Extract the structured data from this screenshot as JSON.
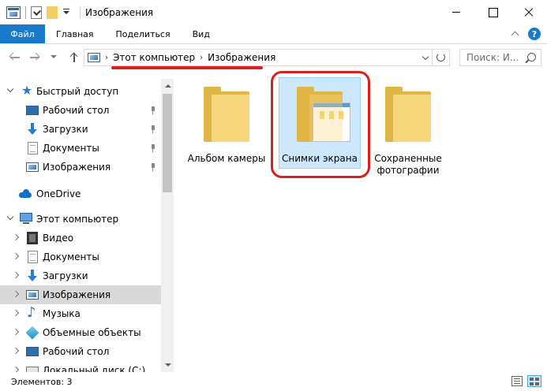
{
  "window": {
    "title": "Изображения"
  },
  "ribbon": {
    "tabs": [
      "Файл",
      "Главная",
      "Поделиться",
      "Вид"
    ]
  },
  "address": {
    "crumbs": [
      "Этот компьютер",
      "Изображения"
    ]
  },
  "search": {
    "placeholder": "Поиск: И..."
  },
  "sidebar": {
    "quick_access": "Быстрый доступ",
    "quick_items": [
      "Рабочий стол",
      "Загрузки",
      "Документы",
      "Изображения"
    ],
    "onedrive": "OneDrive",
    "this_pc": "Этот компьютер",
    "pc_items": [
      "Видео",
      "Документы",
      "Загрузки",
      "Изображения",
      "Музыка",
      "Объемные объекты",
      "Рабочий стол",
      "Локальный диск (C:)"
    ],
    "selected": "Изображения"
  },
  "content": {
    "folders": [
      {
        "name": "Альбом камеры",
        "lines": [
          "Альбом камеры"
        ]
      },
      {
        "name": "Снимки экрана",
        "lines": [
          "Снимки экрана"
        ]
      },
      {
        "name": "Сохраненные фотографии",
        "lines": [
          "Сохраненные",
          "фотографии"
        ]
      }
    ],
    "highlight_color": "#d72020",
    "selection_color": "#cce8ff"
  },
  "status": {
    "count_text": "Элементов: 3"
  }
}
